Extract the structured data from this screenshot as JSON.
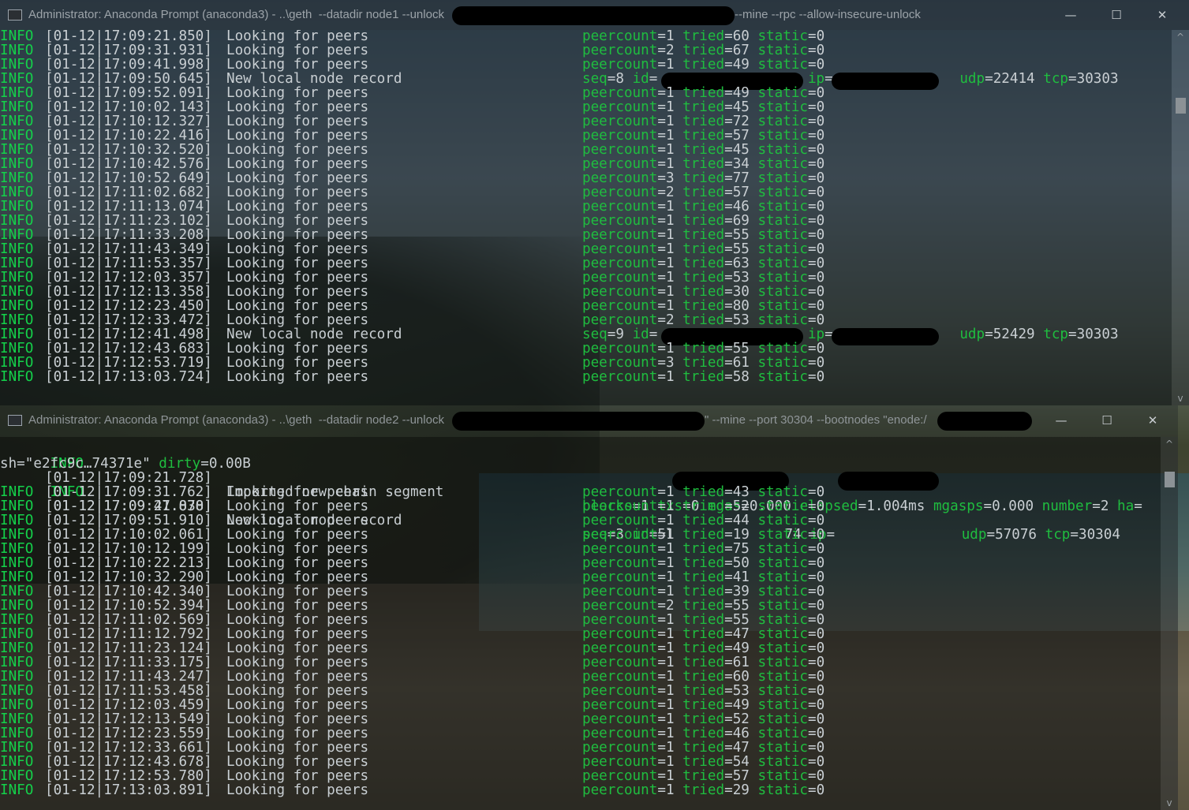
{
  "window1": {
    "title": "Administrator: Anaconda Prompt (anaconda3) - ..\\geth  --datadir node1 --unlock ",
    "title_tail": "--mine --rpc --allow-insecure-unlock",
    "buttons": {
      "minimize": "—",
      "maximize": "☐",
      "close": "✕"
    },
    "lines": [
      {
        "level": "INFO",
        "ts": "[01-12|17:09:21.850]",
        "msg": "Looking for peers",
        "kv": [
          [
            "peercount",
            "1"
          ],
          [
            "tried",
            "60"
          ],
          [
            "static",
            "0"
          ]
        ]
      },
      {
        "level": "INFO",
        "ts": "[01-12|17:09:31.931]",
        "msg": "Looking for peers",
        "kv": [
          [
            "peercount",
            "2"
          ],
          [
            "tried",
            "67"
          ],
          [
            "static",
            "0"
          ]
        ]
      },
      {
        "level": "INFO",
        "ts": "[01-12|17:09:41.998]",
        "msg": "Looking for peers",
        "kv": [
          [
            "peercount",
            "1"
          ],
          [
            "tried",
            "49"
          ],
          [
            "static",
            "0"
          ]
        ]
      },
      {
        "level": "INFO",
        "ts": "[01-12|17:09:50.645]",
        "msg": "New local node record",
        "kv": [
          [
            "seq",
            "8"
          ],
          [
            "id",
            ""
          ],
          [
            "ip",
            ""
          ],
          [
            "udp",
            "22414"
          ],
          [
            "tcp",
            "30303"
          ]
        ]
      },
      {
        "level": "INFO",
        "ts": "[01-12|17:09:52.091]",
        "msg": "Looking for peers",
        "kv": [
          [
            "peercount",
            "1"
          ],
          [
            "tried",
            "49"
          ],
          [
            "static",
            "0"
          ]
        ]
      },
      {
        "level": "INFO",
        "ts": "[01-12|17:10:02.143]",
        "msg": "Looking for peers",
        "kv": [
          [
            "peercount",
            "1"
          ],
          [
            "tried",
            "45"
          ],
          [
            "static",
            "0"
          ]
        ]
      },
      {
        "level": "INFO",
        "ts": "[01-12|17:10:12.327]",
        "msg": "Looking for peers",
        "kv": [
          [
            "peercount",
            "1"
          ],
          [
            "tried",
            "72"
          ],
          [
            "static",
            "0"
          ]
        ]
      },
      {
        "level": "INFO",
        "ts": "[01-12|17:10:22.416]",
        "msg": "Looking for peers",
        "kv": [
          [
            "peercount",
            "1"
          ],
          [
            "tried",
            "57"
          ],
          [
            "static",
            "0"
          ]
        ]
      },
      {
        "level": "INFO",
        "ts": "[01-12|17:10:32.520]",
        "msg": "Looking for peers",
        "kv": [
          [
            "peercount",
            "1"
          ],
          [
            "tried",
            "45"
          ],
          [
            "static",
            "0"
          ]
        ]
      },
      {
        "level": "INFO",
        "ts": "[01-12|17:10:42.576]",
        "msg": "Looking for peers",
        "kv": [
          [
            "peercount",
            "1"
          ],
          [
            "tried",
            "34"
          ],
          [
            "static",
            "0"
          ]
        ]
      },
      {
        "level": "INFO",
        "ts": "[01-12|17:10:52.649]",
        "msg": "Looking for peers",
        "kv": [
          [
            "peercount",
            "3"
          ],
          [
            "tried",
            "77"
          ],
          [
            "static",
            "0"
          ]
        ]
      },
      {
        "level": "INFO",
        "ts": "[01-12|17:11:02.682]",
        "msg": "Looking for peers",
        "kv": [
          [
            "peercount",
            "2"
          ],
          [
            "tried",
            "57"
          ],
          [
            "static",
            "0"
          ]
        ]
      },
      {
        "level": "INFO",
        "ts": "[01-12|17:11:13.074]",
        "msg": "Looking for peers",
        "kv": [
          [
            "peercount",
            "1"
          ],
          [
            "tried",
            "46"
          ],
          [
            "static",
            "0"
          ]
        ]
      },
      {
        "level": "INFO",
        "ts": "[01-12|17:11:23.102]",
        "msg": "Looking for peers",
        "kv": [
          [
            "peercount",
            "1"
          ],
          [
            "tried",
            "69"
          ],
          [
            "static",
            "0"
          ]
        ]
      },
      {
        "level": "INFO",
        "ts": "[01-12|17:11:33.208]",
        "msg": "Looking for peers",
        "kv": [
          [
            "peercount",
            "1"
          ],
          [
            "tried",
            "55"
          ],
          [
            "static",
            "0"
          ]
        ]
      },
      {
        "level": "INFO",
        "ts": "[01-12|17:11:43.349]",
        "msg": "Looking for peers",
        "kv": [
          [
            "peercount",
            "1"
          ],
          [
            "tried",
            "55"
          ],
          [
            "static",
            "0"
          ]
        ]
      },
      {
        "level": "INFO",
        "ts": "[01-12|17:11:53.357]",
        "msg": "Looking for peers",
        "kv": [
          [
            "peercount",
            "1"
          ],
          [
            "tried",
            "63"
          ],
          [
            "static",
            "0"
          ]
        ]
      },
      {
        "level": "INFO",
        "ts": "[01-12|17:12:03.357]",
        "msg": "Looking for peers",
        "kv": [
          [
            "peercount",
            "1"
          ],
          [
            "tried",
            "53"
          ],
          [
            "static",
            "0"
          ]
        ]
      },
      {
        "level": "INFO",
        "ts": "[01-12|17:12:13.358]",
        "msg": "Looking for peers",
        "kv": [
          [
            "peercount",
            "1"
          ],
          [
            "tried",
            "30"
          ],
          [
            "static",
            "0"
          ]
        ]
      },
      {
        "level": "INFO",
        "ts": "[01-12|17:12:23.450]",
        "msg": "Looking for peers",
        "kv": [
          [
            "peercount",
            "1"
          ],
          [
            "tried",
            "80"
          ],
          [
            "static",
            "0"
          ]
        ]
      },
      {
        "level": "INFO",
        "ts": "[01-12|17:12:33.472]",
        "msg": "Looking for peers",
        "kv": [
          [
            "peercount",
            "2"
          ],
          [
            "tried",
            "53"
          ],
          [
            "static",
            "0"
          ]
        ]
      },
      {
        "level": "INFO",
        "ts": "[01-12|17:12:41.498]",
        "msg": "New local node record",
        "kv": [
          [
            "seq",
            "9"
          ],
          [
            "id",
            ""
          ],
          [
            "ip",
            ""
          ],
          [
            "udp",
            "52429"
          ],
          [
            "tcp",
            "30303"
          ]
        ]
      },
      {
        "level": "INFO",
        "ts": "[01-12|17:12:43.683]",
        "msg": "Looking for peers",
        "kv": [
          [
            "peercount",
            "1"
          ],
          [
            "tried",
            "55"
          ],
          [
            "static",
            "0"
          ]
        ]
      },
      {
        "level": "INFO",
        "ts": "[01-12|17:12:53.719]",
        "msg": "Looking for peers",
        "kv": [
          [
            "peercount",
            "3"
          ],
          [
            "tried",
            "61"
          ],
          [
            "static",
            "0"
          ]
        ]
      },
      {
        "level": "INFO",
        "ts": "[01-12|17:13:03.724]",
        "msg": "Looking for peers",
        "kv": [
          [
            "peercount",
            "1"
          ],
          [
            "tried",
            "58"
          ],
          [
            "static",
            "0"
          ]
        ]
      }
    ]
  },
  "window2": {
    "title": "Administrator: Anaconda Prompt (anaconda3) - ..\\geth  --datadir node2 --unlock ",
    "title_tail": "\" --mine --port 30304 --bootnodes \"enode:/",
    "buttons": {
      "minimize": "—",
      "maximize": "☐",
      "close": "✕"
    },
    "first_line": {
      "level": "INFO",
      "ts": "[01-12|17:09:21.728]",
      "msg": "Imported new chain segment",
      "kv": [
        [
          "blocks",
          "1"
        ],
        [
          "txs",
          "0"
        ],
        [
          "mgas",
          "0.000"
        ],
        [
          "elapsed",
          "1.004ms"
        ],
        [
          "mgasps",
          "0.000"
        ],
        [
          "number",
          "2"
        ],
        [
          "ha",
          ""
        ]
      ]
    },
    "wrap_line": {
      "pre": "sh=\"e2fc9c…74371e\" ",
      "key": "dirty",
      "val": "=0.00B"
    },
    "node_line": {
      "level": "INFO",
      "ts": "[01-12|17:09:27.070]",
      "msg": "New local node record",
      "seq": "3",
      "id_prefix": "5l",
      "id_suffix": "74",
      "udp": "57076",
      "tcp": "30304"
    },
    "lines": [
      {
        "level": "INFO",
        "ts": "[01-12|17:09:31.762]",
        "msg": "Looking for peers",
        "kv": [
          [
            "peercount",
            "1"
          ],
          [
            "tried",
            "43"
          ],
          [
            "static",
            "0"
          ]
        ]
      },
      {
        "level": "INFO",
        "ts": "[01-12|17:09:41.838]",
        "msg": "Looking for peers",
        "kv": [
          [
            "peercount",
            "1"
          ],
          [
            "tried",
            "52"
          ],
          [
            "static",
            "0"
          ]
        ]
      },
      {
        "level": "INFO",
        "ts": "[01-12|17:09:51.910]",
        "msg": "Looking for peers",
        "kv": [
          [
            "peercount",
            "1"
          ],
          [
            "tried",
            "44"
          ],
          [
            "static",
            "0"
          ]
        ]
      },
      {
        "level": "INFO",
        "ts": "[01-12|17:10:02.061]",
        "msg": "Looking for peers",
        "kv": [
          [
            "peercount",
            "1"
          ],
          [
            "tried",
            "19"
          ],
          [
            "static",
            "0"
          ]
        ]
      },
      {
        "level": "INFO",
        "ts": "[01-12|17:10:12.199]",
        "msg": "Looking for peers",
        "kv": [
          [
            "peercount",
            "1"
          ],
          [
            "tried",
            "75"
          ],
          [
            "static",
            "0"
          ]
        ]
      },
      {
        "level": "INFO",
        "ts": "[01-12|17:10:22.213]",
        "msg": "Looking for peers",
        "kv": [
          [
            "peercount",
            "1"
          ],
          [
            "tried",
            "50"
          ],
          [
            "static",
            "0"
          ]
        ]
      },
      {
        "level": "INFO",
        "ts": "[01-12|17:10:32.290]",
        "msg": "Looking for peers",
        "kv": [
          [
            "peercount",
            "1"
          ],
          [
            "tried",
            "41"
          ],
          [
            "static",
            "0"
          ]
        ]
      },
      {
        "level": "INFO",
        "ts": "[01-12|17:10:42.340]",
        "msg": "Looking for peers",
        "kv": [
          [
            "peercount",
            "1"
          ],
          [
            "tried",
            "39"
          ],
          [
            "static",
            "0"
          ]
        ]
      },
      {
        "level": "INFO",
        "ts": "[01-12|17:10:52.394]",
        "msg": "Looking for peers",
        "kv": [
          [
            "peercount",
            "2"
          ],
          [
            "tried",
            "55"
          ],
          [
            "static",
            "0"
          ]
        ]
      },
      {
        "level": "INFO",
        "ts": "[01-12|17:11:02.569]",
        "msg": "Looking for peers",
        "kv": [
          [
            "peercount",
            "1"
          ],
          [
            "tried",
            "55"
          ],
          [
            "static",
            "0"
          ]
        ]
      },
      {
        "level": "INFO",
        "ts": "[01-12|17:11:12.792]",
        "msg": "Looking for peers",
        "kv": [
          [
            "peercount",
            "1"
          ],
          [
            "tried",
            "47"
          ],
          [
            "static",
            "0"
          ]
        ]
      },
      {
        "level": "INFO",
        "ts": "[01-12|17:11:23.124]",
        "msg": "Looking for peers",
        "kv": [
          [
            "peercount",
            "1"
          ],
          [
            "tried",
            "49"
          ],
          [
            "static",
            "0"
          ]
        ]
      },
      {
        "level": "INFO",
        "ts": "[01-12|17:11:33.175]",
        "msg": "Looking for peers",
        "kv": [
          [
            "peercount",
            "1"
          ],
          [
            "tried",
            "61"
          ],
          [
            "static",
            "0"
          ]
        ]
      },
      {
        "level": "INFO",
        "ts": "[01-12|17:11:43.247]",
        "msg": "Looking for peers",
        "kv": [
          [
            "peercount",
            "1"
          ],
          [
            "tried",
            "60"
          ],
          [
            "static",
            "0"
          ]
        ]
      },
      {
        "level": "INFO",
        "ts": "[01-12|17:11:53.458]",
        "msg": "Looking for peers",
        "kv": [
          [
            "peercount",
            "1"
          ],
          [
            "tried",
            "53"
          ],
          [
            "static",
            "0"
          ]
        ]
      },
      {
        "level": "INFO",
        "ts": "[01-12|17:12:03.459]",
        "msg": "Looking for peers",
        "kv": [
          [
            "peercount",
            "1"
          ],
          [
            "tried",
            "49"
          ],
          [
            "static",
            "0"
          ]
        ]
      },
      {
        "level": "INFO",
        "ts": "[01-12|17:12:13.549]",
        "msg": "Looking for peers",
        "kv": [
          [
            "peercount",
            "1"
          ],
          [
            "tried",
            "52"
          ],
          [
            "static",
            "0"
          ]
        ]
      },
      {
        "level": "INFO",
        "ts": "[01-12|17:12:23.559]",
        "msg": "Looking for peers",
        "kv": [
          [
            "peercount",
            "1"
          ],
          [
            "tried",
            "46"
          ],
          [
            "static",
            "0"
          ]
        ]
      },
      {
        "level": "INFO",
        "ts": "[01-12|17:12:33.661]",
        "msg": "Looking for peers",
        "kv": [
          [
            "peercount",
            "1"
          ],
          [
            "tried",
            "47"
          ],
          [
            "static",
            "0"
          ]
        ]
      },
      {
        "level": "INFO",
        "ts": "[01-12|17:12:43.678]",
        "msg": "Looking for peers",
        "kv": [
          [
            "peercount",
            "1"
          ],
          [
            "tried",
            "54"
          ],
          [
            "static",
            "0"
          ]
        ]
      },
      {
        "level": "INFO",
        "ts": "[01-12|17:12:53.780]",
        "msg": "Looking for peers",
        "kv": [
          [
            "peercount",
            "1"
          ],
          [
            "tried",
            "57"
          ],
          [
            "static",
            "0"
          ]
        ]
      },
      {
        "level": "INFO",
        "ts": "[01-12|17:13:03.891]",
        "msg": "Looking for peers",
        "kv": [
          [
            "peercount",
            "1"
          ],
          [
            "tried",
            "29"
          ],
          [
            "static",
            "0"
          ]
        ]
      }
    ]
  },
  "scrollbar": {
    "up": "^",
    "down": "v"
  },
  "colors": {
    "info": "#14d14a",
    "key": "#1fbd3f",
    "text": "#c9cfd3"
  }
}
